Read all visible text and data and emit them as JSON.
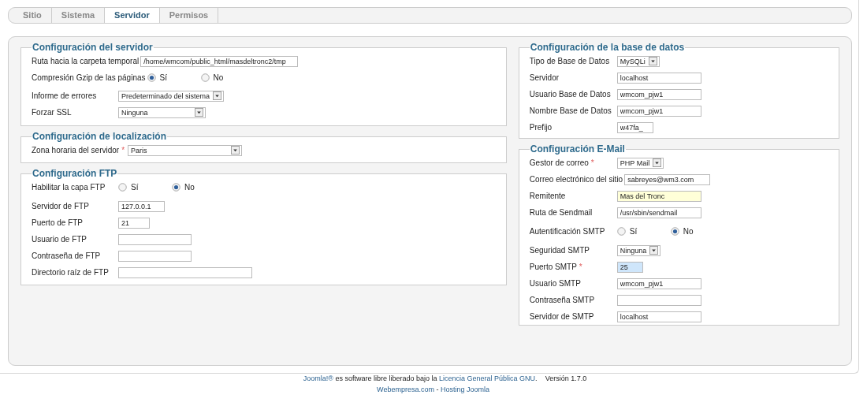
{
  "tabs": [
    {
      "label": "Sitio",
      "selected": false
    },
    {
      "label": "Sistema",
      "selected": false
    },
    {
      "label": "Servidor",
      "selected": true
    },
    {
      "label": "Permisos",
      "selected": false
    }
  ],
  "columns": [
    {
      "sections": [
        {
          "title": "Configuración del servidor",
          "fields": [
            {
              "kind": "text",
              "label": "Ruta hacia la carpeta temporal",
              "value": "/home/wmcom/public_html/masdeltronc2/tmp",
              "focused": false,
              "text_selected": false
            },
            {
              "kind": "radio",
              "label": "Compresión Gzip de las páginas",
              "options": [
                {
                  "label": "Sí",
                  "selected": true
                },
                {
                  "label": "No",
                  "selected": false
                }
              ]
            },
            {
              "kind": "select",
              "label": "Informe de errores",
              "value": "Predeterminado del sistema"
            },
            {
              "kind": "select",
              "label": "Forzar SSL",
              "value": "Ninguna"
            }
          ]
        },
        {
          "title": "Configuración de localización",
          "fields": [
            {
              "kind": "select",
              "label": "Zona horaria del servidor",
              "required_mark": "*",
              "value": "Paris"
            }
          ]
        },
        {
          "title": "Configuración FTP",
          "fields": [
            {
              "kind": "radio",
              "label": "Habilitar la capa FTP",
              "options": [
                {
                  "label": "Sí",
                  "selected": false
                },
                {
                  "label": "No",
                  "selected": true
                }
              ]
            },
            {
              "kind": "text",
              "label": "Servidor de FTP",
              "value": "127.0.0.1",
              "focused": false,
              "text_selected": false
            },
            {
              "kind": "text",
              "label": "Puerto de FTP",
              "value": "21",
              "focused": false,
              "text_selected": false
            },
            {
              "kind": "text",
              "label": "Usuario de FTP",
              "focused": false,
              "text_selected": false
            },
            {
              "kind": "text",
              "label": "Contraseña de FTP",
              "focused": false,
              "text_selected": false
            },
            {
              "kind": "text",
              "label": "Directorio raíz de FTP",
              "focused": false,
              "text_selected": false
            }
          ]
        }
      ]
    },
    {
      "sections": [
        {
          "title": "Configuración de la base de datos",
          "fields": [
            {
              "kind": "select",
              "label": "Tipo de Base de Datos",
              "value": "MySQLi"
            },
            {
              "kind": "text",
              "label": "Servidor",
              "value": "localhost",
              "focused": false,
              "text_selected": false
            },
            {
              "kind": "text",
              "label": "Usuario Base de Datos",
              "value": "wmcom_pjw1",
              "focused": false,
              "text_selected": false
            },
            {
              "kind": "text",
              "label": "Nombre Base de Datos",
              "value": "wmcom_pjw1",
              "focused": false,
              "text_selected": false
            },
            {
              "kind": "text",
              "label": "Prefijo",
              "value": "w47fa_",
              "focused": false,
              "text_selected": false
            }
          ]
        },
        {
          "title": "Configuración E-Mail",
          "fields": [
            {
              "kind": "select",
              "label": "Gestor de correo",
              "required_mark": "*",
              "value": "PHP Mail"
            },
            {
              "kind": "text",
              "label": "Correo electrónico del sitio",
              "value": "sabreyes@wm3.com",
              "focused": false,
              "text_selected": false
            },
            {
              "kind": "text",
              "label": "Remitente",
              "value": "Mas del Tronc",
              "focused": true,
              "text_selected": false
            },
            {
              "kind": "text",
              "label": "Ruta de Sendmail",
              "value": "/usr/sbin/sendmail",
              "focused": false,
              "text_selected": false
            },
            {
              "kind": "radio",
              "label": "Autentificación SMTP",
              "options": [
                {
                  "label": "Sí",
                  "selected": false
                },
                {
                  "label": "No",
                  "selected": true
                }
              ]
            },
            {
              "kind": "select",
              "label": "Seguridad SMTP",
              "value": "Ninguna"
            },
            {
              "kind": "text",
              "label": "Puerto SMTP",
              "required_mark": "*",
              "value": "25",
              "focused": false,
              "text_selected": true
            },
            {
              "kind": "text",
              "label": "Usuario SMTP",
              "value": "wmcom_pjw1",
              "focused": false,
              "text_selected": false
            },
            {
              "kind": "text",
              "label": "Contraseña SMTP",
              "focused": false,
              "text_selected": false
            },
            {
              "kind": "text",
              "label": "Servidor de SMTP",
              "value": "localhost",
              "focused": false,
              "text_selected": false
            }
          ]
        }
      ]
    }
  ],
  "footer": {
    "line1": [
      {
        "kind": "link",
        "text": "Joomla!®"
      },
      {
        "kind": "text",
        "text": " es software libre liberado bajo la "
      },
      {
        "kind": "link",
        "text": "Licencia General Pública GNU"
      },
      {
        "kind": "text",
        "text": "."
      }
    ],
    "version": "Versión 1.7.0",
    "line2": [
      {
        "kind": "link",
        "text": "Webempresa.com"
      },
      {
        "kind": "text",
        "text": " - "
      },
      {
        "kind": "link",
        "text": "Hosting Joomla"
      }
    ]
  }
}
